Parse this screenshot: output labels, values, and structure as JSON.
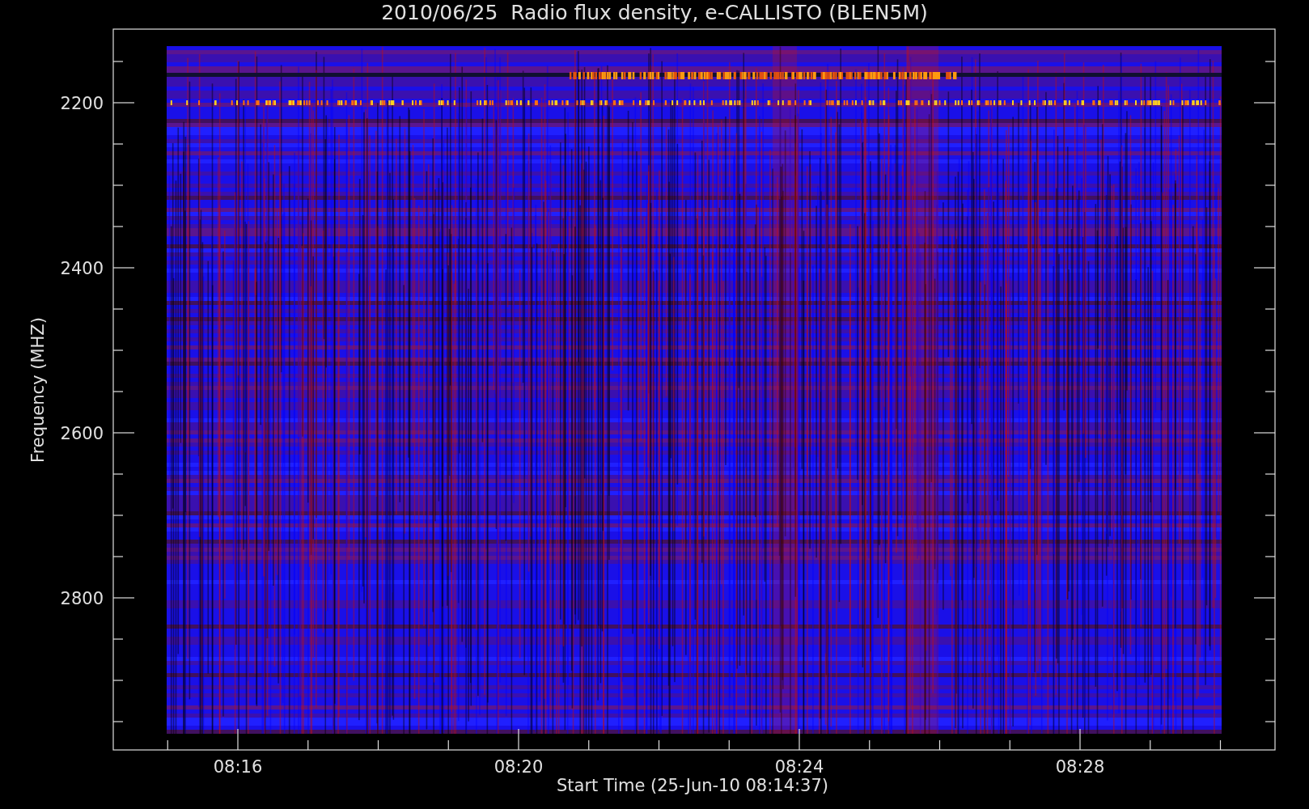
{
  "title": "2010/06/25  Radio flux density, e-CALLISTO (BLEN5M)",
  "y_axis": {
    "label": "Frequency (MHZ)",
    "tick_labels": [
      "2200",
      "2400",
      "2600",
      "2800"
    ]
  },
  "x_axis": {
    "label": "Start Time (25-Jun-10 08:14:37)",
    "tick_labels": [
      "08:16",
      "08:20",
      "08:24",
      "08:28"
    ]
  }
}
